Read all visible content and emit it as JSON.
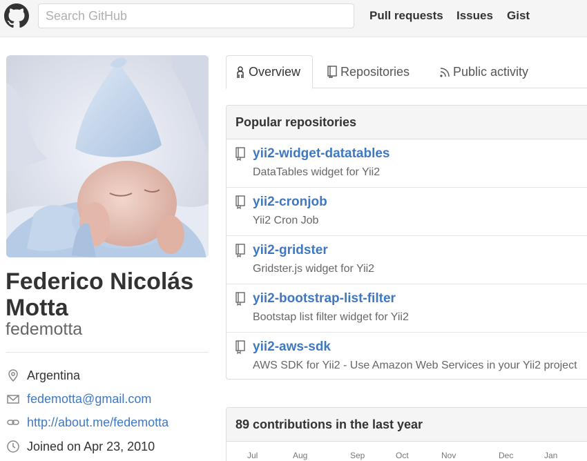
{
  "header": {
    "search_placeholder": "Search GitHub",
    "nav": [
      "Pull requests",
      "Issues",
      "Gist"
    ]
  },
  "profile": {
    "fullname": "Federico Nicolás Motta",
    "username": "fedemotta",
    "location": "Argentina",
    "email": "fedemotta@gmail.com",
    "website": "http://about.me/fedemotta",
    "joined": "Joined on Apr 23, 2010"
  },
  "tabs": [
    {
      "label": "Overview",
      "icon": "person-icon"
    },
    {
      "label": "Repositories",
      "icon": "repo-icon"
    },
    {
      "label": "Public activity",
      "icon": "rss-icon"
    }
  ],
  "popular": {
    "title": "Popular repositories",
    "repos": [
      {
        "name": "yii2-widget-datatables",
        "desc": "DataTables widget for Yii2"
      },
      {
        "name": "yii2-cronjob",
        "desc": "Yii2 Cron Job"
      },
      {
        "name": "yii2-gridster",
        "desc": "Gridster.js widget for Yii2"
      },
      {
        "name": "yii2-bootstrap-list-filter",
        "desc": "Bootstap list filter widget for Yii2"
      },
      {
        "name": "yii2-aws-sdk",
        "desc": "AWS SDK for Yii2 - Use Amazon Web Services in your Yii2 project"
      }
    ]
  },
  "contributions": {
    "title": "89 contributions in the last year",
    "months": [
      "Jul",
      "Aug",
      "Sep",
      "Oct",
      "Nov",
      "Dec",
      "Jan"
    ]
  },
  "colors": {
    "link": "#4078c0",
    "header_bg": "#f5f5f5",
    "border": "#dddddd"
  }
}
